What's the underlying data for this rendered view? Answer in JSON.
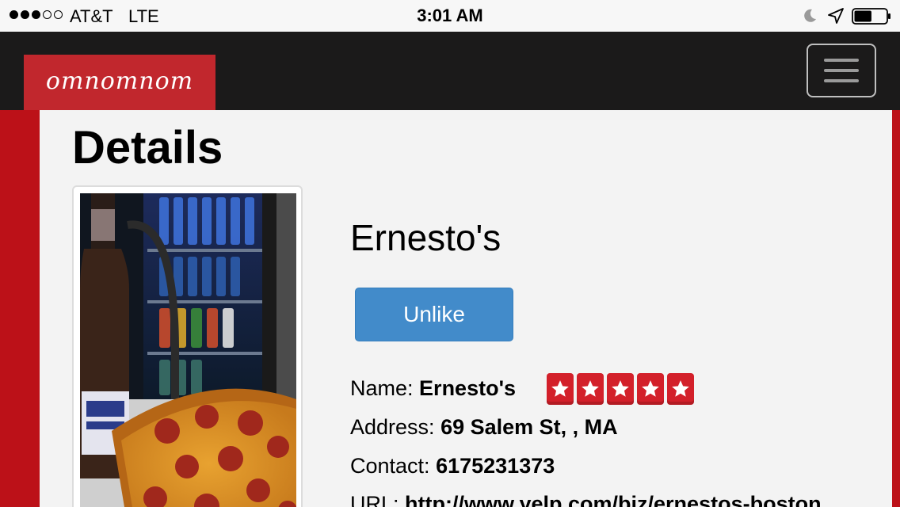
{
  "status_bar": {
    "carrier": "AT&T",
    "network": "LTE",
    "time": "3:01 AM",
    "signal_bars_filled": 3,
    "signal_bars_total": 5,
    "battery_level": 0.55,
    "icons": [
      "moon-icon",
      "location-arrow-icon",
      "battery-icon"
    ]
  },
  "navbar": {
    "brand": "omnomnom",
    "brand_color": "#c1272d",
    "menu_icon": "hamburger-icon"
  },
  "page": {
    "title": "Details"
  },
  "restaurant": {
    "name": "Ernesto's",
    "unlike_label": "Unlike",
    "name_label": "Name:",
    "name_value": "Ernesto's",
    "rating": 5,
    "rating_max": 5,
    "address_label": "Address:",
    "address_value": "69 Salem St, , MA",
    "contact_label": "Contact:",
    "contact_value": "6175231373",
    "url_label": "URL:",
    "url_value": "http://www.yelp.com/biz/ernestos-boston"
  },
  "colors": {
    "accent_red": "#bc1118",
    "button_blue": "#428bca",
    "navbar_bg": "#1b1a1a"
  }
}
